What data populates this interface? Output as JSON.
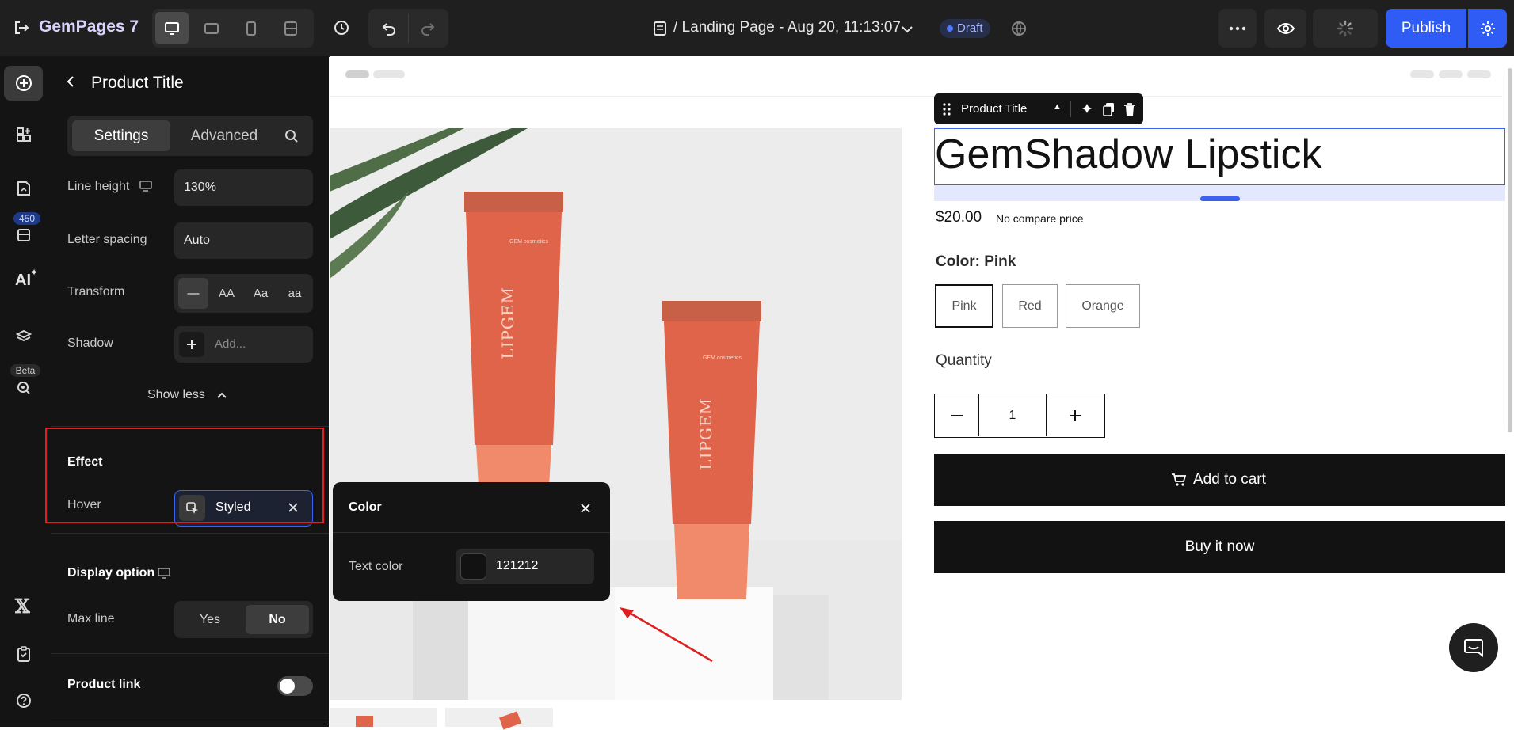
{
  "app": {
    "name": "GemPages 7",
    "page_title": "/ Landing Page - Aug 20, 11:13:07",
    "status_badge": "Draft",
    "publish_label": "Publish"
  },
  "rail": {
    "badge_count": "450",
    "ai_label": "AI",
    "beta_label": "Beta"
  },
  "panel": {
    "title": "Product Title",
    "tabs": {
      "settings": "Settings",
      "advanced": "Advanced"
    },
    "line_height": {
      "label": "Line height",
      "value": "130%"
    },
    "letter_spacing": {
      "label": "Letter spacing",
      "value": "Auto"
    },
    "transform": {
      "label": "Transform",
      "options": [
        "—",
        "AA",
        "Aa",
        "aa"
      ]
    },
    "shadow": {
      "label": "Shadow",
      "placeholder": "Add..."
    },
    "show_less": "Show less",
    "effect": {
      "heading": "Effect",
      "hover_label": "Hover",
      "hover_value": "Styled"
    },
    "display_option": {
      "heading": "Display option",
      "max_line_label": "Max line",
      "yes": "Yes",
      "no": "No"
    },
    "product_link": {
      "label": "Product link",
      "enabled": false
    }
  },
  "color_popup": {
    "title": "Color",
    "text_color_label": "Text color",
    "value": "121212",
    "swatch": "#121212"
  },
  "product": {
    "toolbar_label": "Product Title",
    "title": "GemShadow Lipstick",
    "price": "$20.00",
    "compare_price": "No compare price",
    "color_label": "Color: Pink",
    "variants": [
      "Pink",
      "Red",
      "Orange"
    ],
    "selected_variant": "Pink",
    "quantity_label": "Quantity",
    "quantity": "1",
    "add_to_cart": "Add to cart",
    "buy_now": "Buy it now",
    "tube_brand": "LIPGEM",
    "tube_logo": "GEM cosmetics"
  },
  "colors": {
    "accent": "#2f5cf4",
    "dark": "#141414",
    "highlight_box": "#e02020",
    "annotation_arrow": "#e02020",
    "lipstick": "#e0644a"
  }
}
